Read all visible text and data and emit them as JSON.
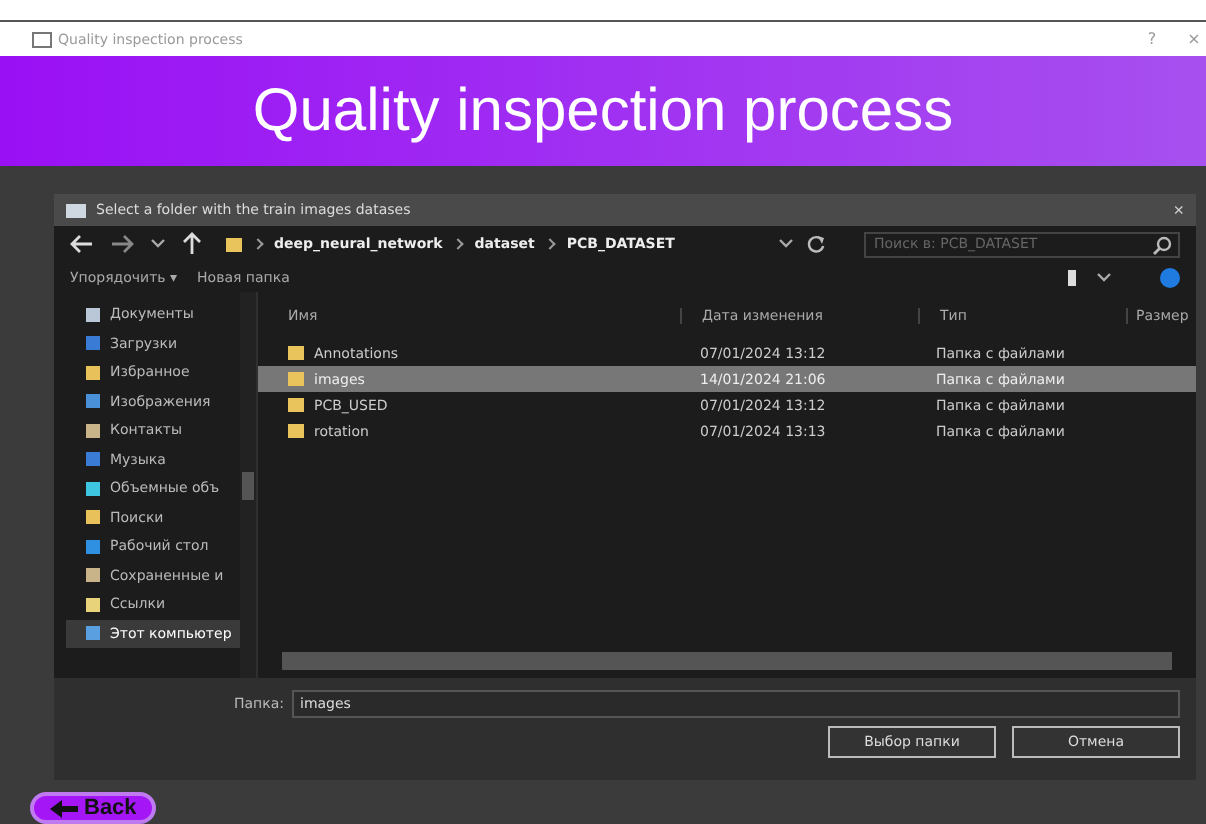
{
  "window": {
    "title": "Quality inspection process",
    "help": "?",
    "close": "×"
  },
  "header": {
    "title": "Quality inspection process"
  },
  "dialog": {
    "title": "Select a folder with the train images datases",
    "close": "×",
    "breadcrumbs": [
      "deep_neural_network",
      "dataset",
      "PCB_DATASET"
    ],
    "search": {
      "placeholder": "Поиск в: PCB_DATASET"
    },
    "toolbar": {
      "organize": "Упорядочить ▾",
      "new_folder": "Новая папка"
    },
    "sidebar": [
      {
        "label": "Документы",
        "color": "#b9c7d6",
        "selected": false
      },
      {
        "label": "Загрузки",
        "color": "#3a7bd5",
        "selected": false
      },
      {
        "label": "Избранное",
        "color": "#e8c15a",
        "selected": false
      },
      {
        "label": "Изображения",
        "color": "#4a90d9",
        "selected": false
      },
      {
        "label": "Контакты",
        "color": "#c9b48a",
        "selected": false
      },
      {
        "label": "Музыка",
        "color": "#3a7bd5",
        "selected": false
      },
      {
        "label": "Объемные объ",
        "color": "#3ec6e0",
        "selected": false
      },
      {
        "label": "Поиски",
        "color": "#e8c15a",
        "selected": false
      },
      {
        "label": "Рабочий стол",
        "color": "#2f8fe0",
        "selected": false
      },
      {
        "label": "Сохраненные и",
        "color": "#c9b48a",
        "selected": false
      },
      {
        "label": "Ссылки",
        "color": "#e8d27a",
        "selected": false
      },
      {
        "label": "Этот компьютер",
        "color": "#5aa0e0",
        "selected": true
      }
    ],
    "columns": [
      "Имя",
      "Дата изменения",
      "Тип",
      "Размер"
    ],
    "rows": [
      {
        "name": "Annotations",
        "date": "07/01/2024 13:12",
        "type": "Папка с файлами",
        "selected": false
      },
      {
        "name": "images",
        "date": "14/01/2024 21:06",
        "type": "Папка с файлами",
        "selected": true
      },
      {
        "name": "PCB_USED",
        "date": "07/01/2024 13:12",
        "type": "Папка с файлами",
        "selected": false
      },
      {
        "name": "rotation",
        "date": "07/01/2024 13:13",
        "type": "Папка с файлами",
        "selected": false
      }
    ],
    "folder": {
      "label": "Папка:",
      "value": "images"
    },
    "buttons": [
      "Выбор папки",
      "Отмена"
    ]
  },
  "back_button": {
    "label": "Back"
  }
}
